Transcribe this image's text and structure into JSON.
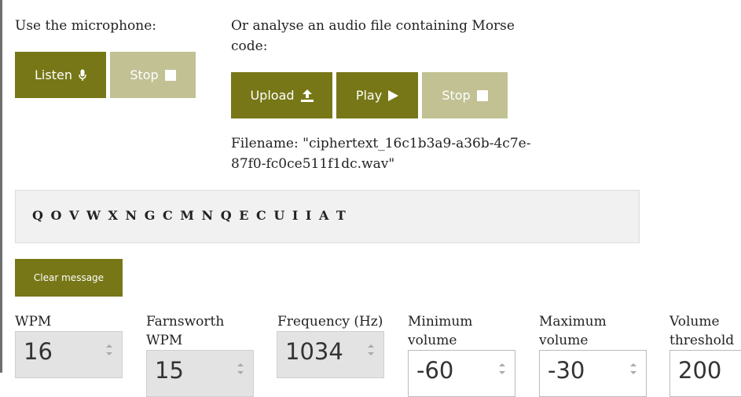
{
  "microphone": {
    "label": "Use the microphone:",
    "listen_label": "Listen",
    "stop_label": "Stop"
  },
  "file": {
    "label_line1": "Or analyse an audio file containing Morse",
    "label_line2": "code:",
    "upload_label": "Upload",
    "play_label": "Play",
    "stop_label": "Stop",
    "filename_line1": "Filename: \"ciphertext_16c1b3a9-a36b-4c7e-",
    "filename_line2": "87f0-fc0ce511f1dc.wav\""
  },
  "message": {
    "text": "QOVWXNGCMNQECUIIAT",
    "clear_label": "Clear message"
  },
  "settings": {
    "wpm": {
      "label_line1": "WPM",
      "label_line2": "",
      "value": "16"
    },
    "farnsworth": {
      "label_line1": "Farnsworth",
      "label_line2": "WPM",
      "value": "15"
    },
    "frequency": {
      "label_line1": "Frequency (Hz)",
      "label_line2": "",
      "value": "1034"
    },
    "min_volume": {
      "label_line1": "Minimum",
      "label_line2": "volume",
      "value": "-60"
    },
    "max_volume": {
      "label_line1": "Maximum",
      "label_line2": "volume",
      "value": "-30"
    },
    "threshold": {
      "label_line1": "Volume",
      "label_line2": "threshold",
      "value": "200"
    }
  },
  "icons": {
    "listen": "microphone-icon",
    "stop": "stop-square-icon",
    "upload": "upload-icon",
    "play": "play-icon"
  },
  "colors": {
    "button_active": "#777717",
    "button_disabled": "#c1c194",
    "message_bg": "#f1f1f1"
  }
}
